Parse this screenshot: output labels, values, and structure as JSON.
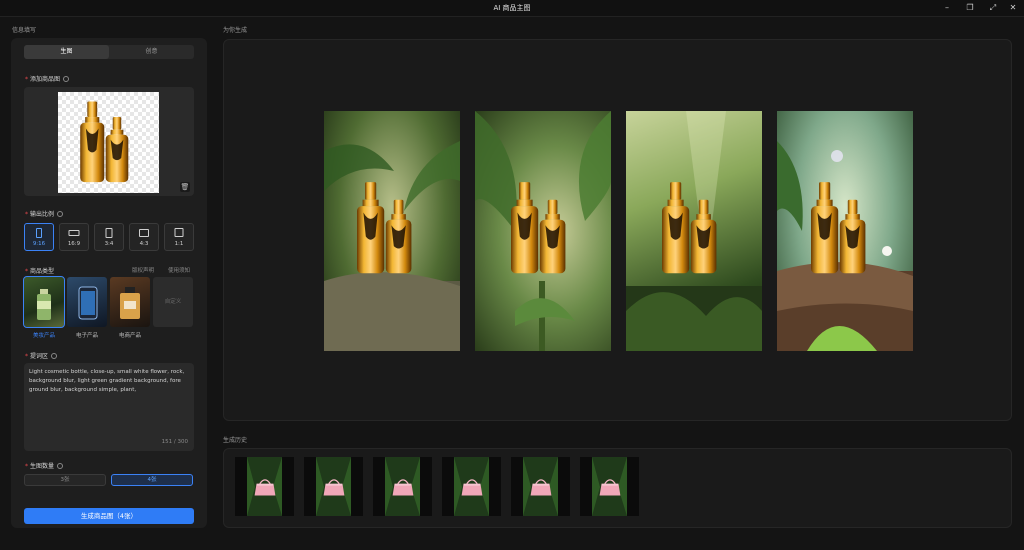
{
  "window": {
    "title": "AI 商品主图"
  },
  "left": {
    "section_label": "信息填写",
    "tabs": [
      "生图",
      "创意"
    ],
    "upload_label": "添加商品图",
    "ratio_label": "输出比例",
    "ratios": [
      "9:16",
      "16:9",
      "3:4",
      "4:3",
      "1:1"
    ],
    "type_label": "商品类型",
    "type_links": [
      "版权声明",
      "使用须知"
    ],
    "types": [
      "美妆产品",
      "电子产品",
      "电商产品"
    ],
    "custom_label": "自定义",
    "prompt_label": "提词区",
    "prompt_text": "Light cosmetic bottle, close-up, small white flower, rock, background blur, light green gradient background, fore ground blur, background simple, plant,",
    "prompt_count": "151 / 300",
    "count_label": "生图数量",
    "counts": [
      "3张",
      "4张"
    ],
    "generate_label": "生成商品图（4张）"
  },
  "right": {
    "result_label": "为你生成",
    "history_label": "生成历史"
  },
  "colors": {
    "accent": "#2f7cf6",
    "required": "#e5484d",
    "bottle_gold": "#d99a1a"
  },
  "icons": [
    "minimize-icon",
    "restore-icon",
    "fullscreen-icon",
    "close-icon",
    "info-icon",
    "trash-icon",
    "handbag-icon",
    "bottle-icon"
  ]
}
